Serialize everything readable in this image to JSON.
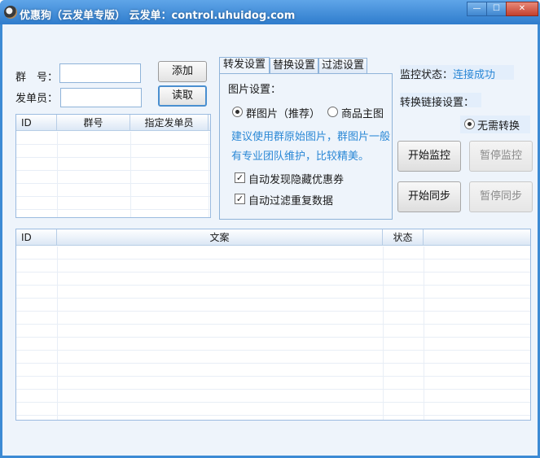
{
  "window": {
    "title": "优惠狗（云发单专版） 云发单：control.uhuidog.com",
    "minimize_glyph": "—",
    "maximize_glyph": "☐",
    "close_glyph": "✕"
  },
  "form": {
    "group_label": "群　号：",
    "group_value": "",
    "sender_label": "发单员：",
    "sender_value": "",
    "add_button": "添加",
    "read_button": "读取"
  },
  "group_table": {
    "columns": [
      "ID",
      "群号",
      "指定发单员"
    ],
    "rows": []
  },
  "settings": {
    "tabs": [
      "转发设置",
      "替换设置",
      "过滤设置"
    ],
    "active_tab": 0,
    "image_setting_label": "图片设置：",
    "radio_group_image": "群图片（推荐）",
    "radio_product_image": "商品主图",
    "hint_line1": "建议使用群原始图片，群图片一般",
    "hint_line2": "有专业团队维护，比较精美。",
    "check_hidden_coupon": "自动发现隐藏优惠券",
    "check_filter_duplicate": "自动过滤重复数据"
  },
  "monitor": {
    "status_label": "监控状态：",
    "status_value": "连接成功",
    "status_color": "#2b88d6",
    "link_convert_label": "转换链接设置：",
    "no_convert_option": "无需转换",
    "start_monitor": "开始监控",
    "pause_monitor": "暂停监控",
    "start_sync": "开始同步",
    "pause_sync": "暂停同步"
  },
  "copy_table": {
    "columns": [
      "ID",
      "文案",
      "状态"
    ],
    "rows": []
  }
}
